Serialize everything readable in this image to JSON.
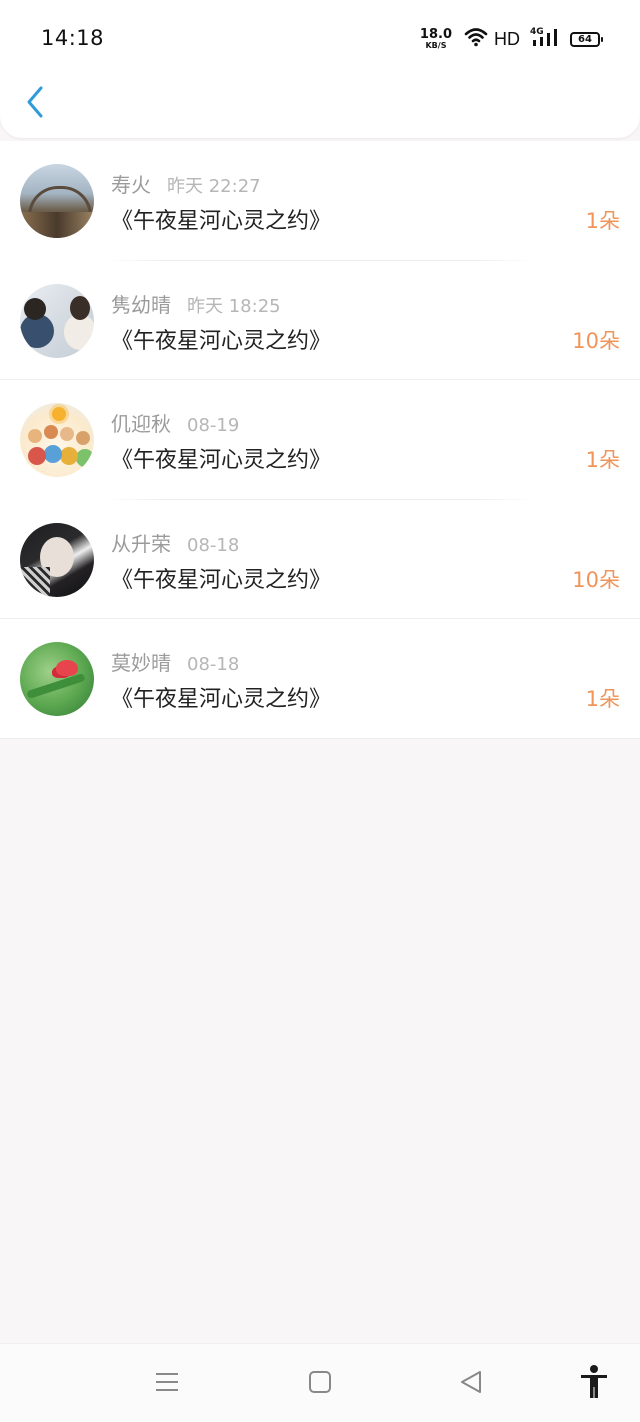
{
  "status_bar": {
    "time": "14:18",
    "net_speed_value": "18.0",
    "net_speed_unit": "KB/S",
    "hd": "HD",
    "network": "4G",
    "battery": "64"
  },
  "header": {
    "back_icon": "chevron-left-icon",
    "accent_color": "#2f9bd9"
  },
  "records": [
    {
      "name": "寿火",
      "date": "昨天 22:27",
      "book": "《午夜星河心灵之约》",
      "count": "1朵"
    },
    {
      "name": "隽幼晴",
      "date": "昨天 18:25",
      "book": "《午夜星河心灵之约》",
      "count": "10朵"
    },
    {
      "name": "仉迎秋",
      "date": "08-19",
      "book": "《午夜星河心灵之约》",
      "count": "1朵"
    },
    {
      "name": "从升荣",
      "date": "08-18",
      "book": "《午夜星河心灵之约》",
      "count": "10朵"
    },
    {
      "name": "莫妙晴",
      "date": "08-18",
      "book": "《午夜星河心灵之约》",
      "count": "1朵"
    }
  ],
  "colors": {
    "count": "#f0945a",
    "name": "#9b9b9b",
    "date": "#b6b6b6",
    "background": "#f8f6f7"
  },
  "nav_bar": {
    "icons": [
      "menu-icon",
      "home-square-icon",
      "back-triangle-icon",
      "accessibility-icon"
    ]
  }
}
